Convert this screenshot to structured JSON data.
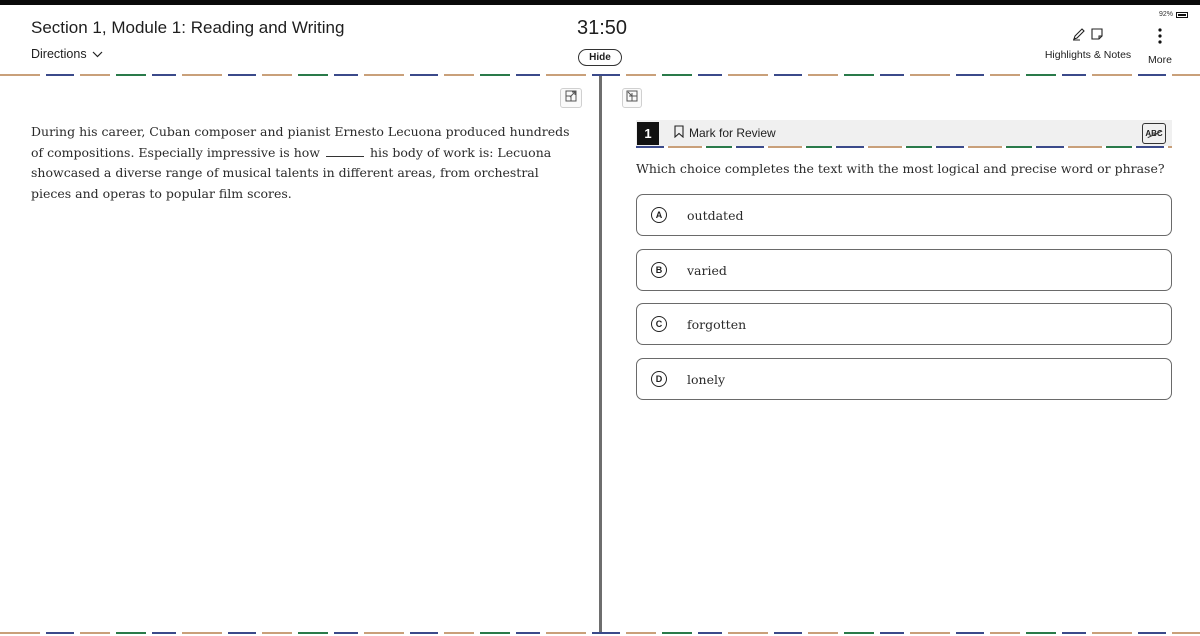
{
  "header": {
    "section_title": "Section 1, Module 1: Reading and Writing",
    "directions_label": "Directions",
    "timer": "31:50",
    "hide_label": "Hide",
    "battery": "92%",
    "highlights_label": "Highlights & Notes",
    "more_label": "More"
  },
  "passage": {
    "before_blank": "During his career, Cuban composer and pianist Ernesto Lecuona produced hundreds of compositions. Especially impressive is how",
    "after_blank": "his body of work is: Lecuona showcased a diverse range of musical talents in different areas, from orchestral pieces and operas to popular film scores."
  },
  "question": {
    "number": "1",
    "mark_label": "Mark for Review",
    "abc_label": "ABC",
    "prompt": "Which choice completes the text with the most logical and precise word or phrase?",
    "choices": [
      {
        "letter": "A",
        "text": "outdated"
      },
      {
        "letter": "B",
        "text": "varied"
      },
      {
        "letter": "C",
        "text": "forgotten"
      },
      {
        "letter": "D",
        "text": "lonely"
      }
    ]
  },
  "icons": {
    "directions_chevron": "chevron-down-icon",
    "highlight": "pen-icon",
    "note": "note-icon",
    "more": "more-vertical-icon",
    "expand": "expand-icon",
    "collapse": "collapse-icon",
    "bookmark": "bookmark-icon",
    "battery": "battery-icon"
  }
}
